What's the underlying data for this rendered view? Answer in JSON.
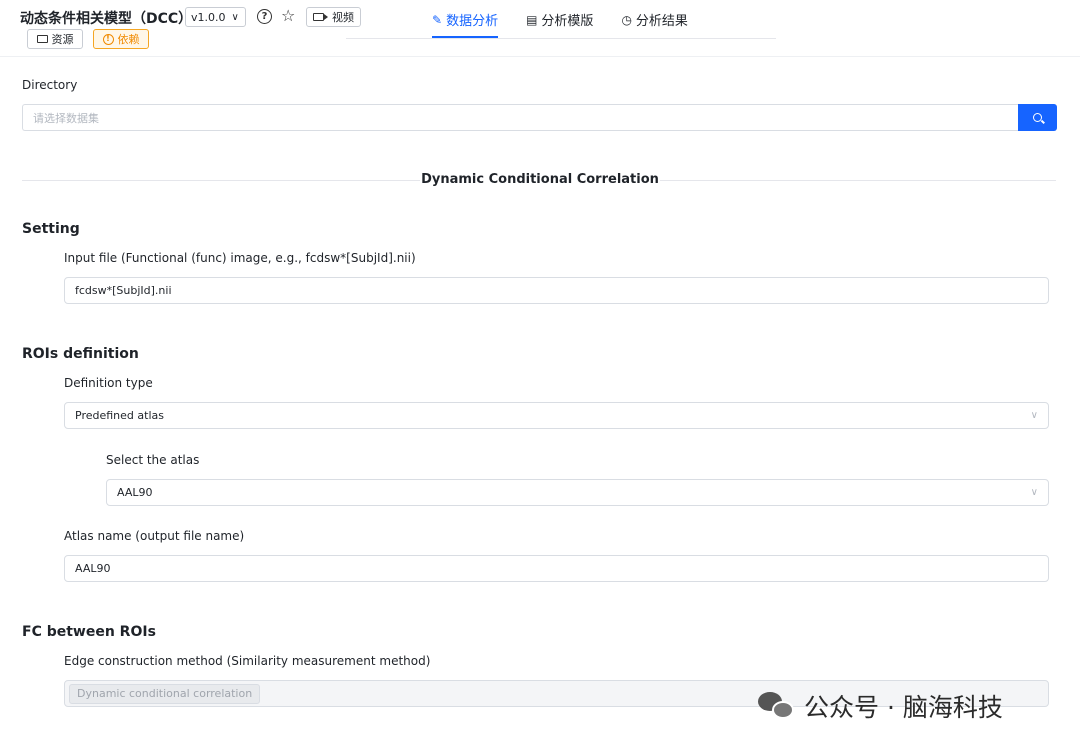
{
  "header": {
    "title": "动态条件相关模型（DCC）",
    "version": "v1.0.0",
    "video_label": "视频",
    "resources_label": "资源",
    "dependency_label": "依赖",
    "tabs": [
      {
        "label": "数据分析",
        "icon": "edit-icon",
        "active": true
      },
      {
        "label": "分析模版",
        "icon": "document-icon",
        "active": false
      },
      {
        "label": "分析结果",
        "icon": "history-icon",
        "active": false
      }
    ],
    "accent": "#1664ff"
  },
  "directory": {
    "label": "Directory",
    "placeholder": "请选择数据集"
  },
  "section_title": "Dynamic Conditional Correlation",
  "setting": {
    "heading": "Setting",
    "input_file_label": "Input file (Functional (func) image, e.g., fcdsw*[SubjId].nii)",
    "input_file_value": "fcdsw*[SubjId].nii"
  },
  "rois": {
    "heading": "ROIs definition",
    "definition_type_label": "Definition type",
    "definition_type_value": "Predefined atlas",
    "atlas_select_label": "Select the atlas",
    "atlas_select_value": "AAL90",
    "atlas_name_label": "Atlas name (output file name)",
    "atlas_name_value": "AAL90"
  },
  "fc": {
    "heading": "FC between ROIs",
    "edge_method_label": "Edge construction method (Similarity measurement method)",
    "edge_method_value": "Dynamic conditional correlation"
  },
  "watermark": "公众号 · 脑海科技"
}
